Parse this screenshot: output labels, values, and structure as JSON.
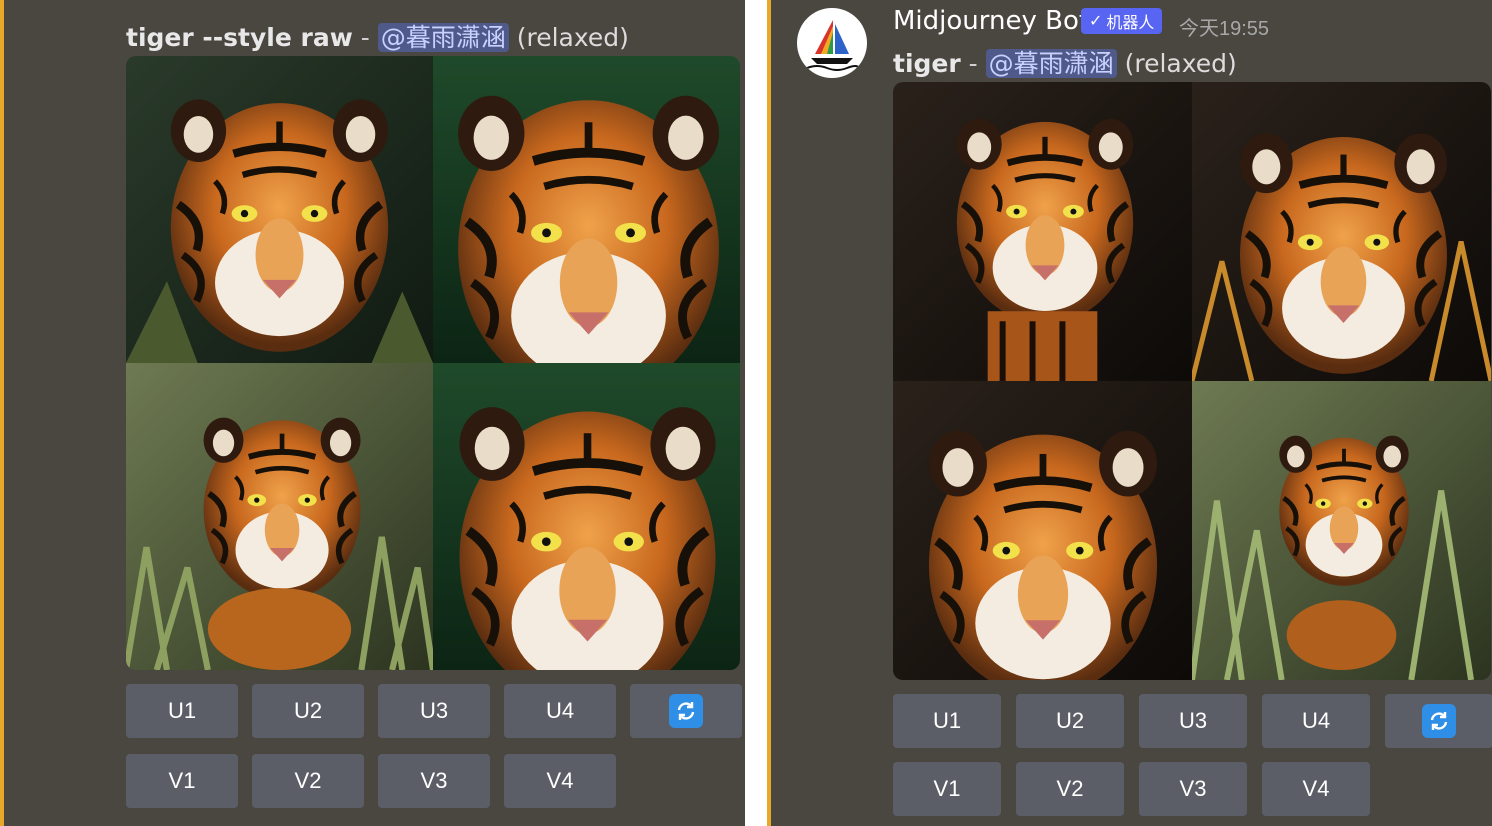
{
  "left": {
    "prompt": {
      "text": "tiger --style raw",
      "separator": "-",
      "mention": "@暮雨潇涵",
      "mode": "(relaxed)"
    },
    "upscale_buttons": [
      "U1",
      "U2",
      "U3",
      "U4"
    ],
    "variation_buttons": [
      "V1",
      "V2",
      "V3",
      "V4"
    ],
    "refresh_icon": "refresh-icon"
  },
  "right": {
    "bot": {
      "name": "Midjourney Bot",
      "badge": "机器人",
      "badge_check": "✓",
      "timestamp": "今天19:55"
    },
    "prompt": {
      "text": "tiger",
      "separator": "-",
      "mention": "@暮雨潇涵",
      "mode": "(relaxed)"
    },
    "upscale_buttons": [
      "U1",
      "U2",
      "U3",
      "U4"
    ],
    "variation_buttons": [
      "V1",
      "V2",
      "V3",
      "V4"
    ],
    "refresh_icon": "refresh-icon"
  },
  "colors": {
    "panel_bg": "#4a4640",
    "accent_border": "#e8a92a",
    "button_bg": "#5b5e67",
    "mention_bg": "#4f5a8a",
    "badge_bg": "#5865f2",
    "refresh_bg": "#2f8fe6"
  }
}
